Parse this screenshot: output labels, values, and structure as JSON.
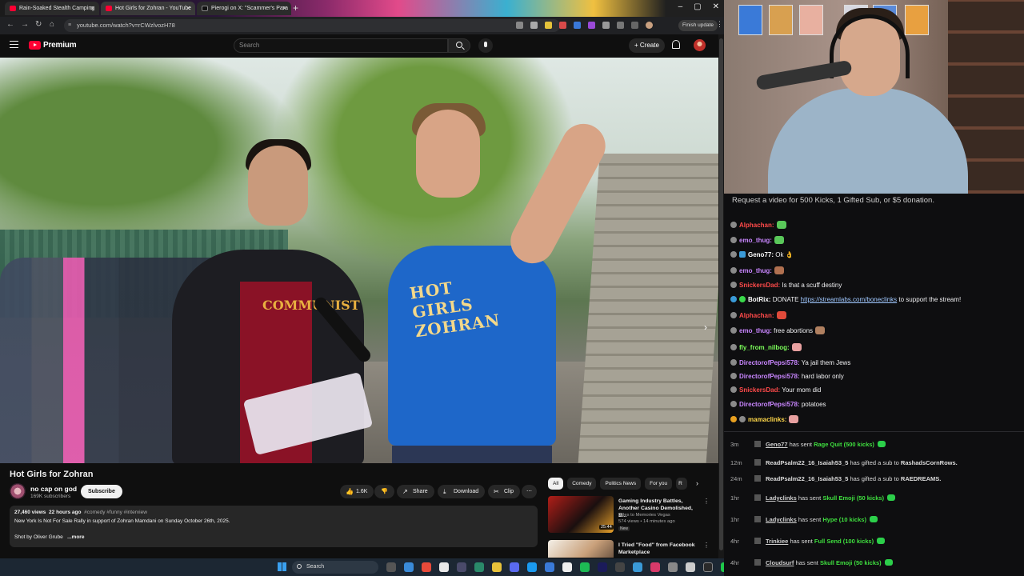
{
  "browser": {
    "tabs": [
      {
        "label": "Rain-Soaked Stealth Camping"
      },
      {
        "label": "Hot Girls for Zohran - YouTube"
      },
      {
        "label": "Pierogi on X: \"Scammer's Para"
      }
    ],
    "url": "youtube.com/watch?v=rCWzlvozH78",
    "finish_update": "Finish update"
  },
  "youtube": {
    "logo_text": "Premium",
    "search_placeholder": "Search",
    "create_label": "Create",
    "video": {
      "shirt_text": "HOT GIRLS ZOHRAN",
      "shirt_text2": "COMMUNIST",
      "title": "Hot Girls for Zohran",
      "channel": "no cap on god",
      "subscribers": "169K subscribers",
      "subscribe_label": "Subscribe",
      "likes": "1.6K",
      "share_label": "Share",
      "download_label": "Download",
      "clip_label": "Clip",
      "views": "27,460 views",
      "age": "22 hours ago",
      "tags": "#comedy #funny #interview",
      "description": "New York Is Not For Sale Rally in support of Zohran Mamdani on Sunday October 26th, 2025.",
      "shot_by": "Shot by Oliver Grube",
      "more_label": "...more"
    },
    "chips": [
      "All",
      "Comedy",
      "Politics News",
      "For you",
      "R"
    ],
    "recommendations": [
      {
        "title": "Gaming Industry Battles, Another Casino Demolished, B...",
        "channel": "Miles to Memories Vegas",
        "stats": "574 views • 14 minutes ago",
        "badge": "New",
        "duration": "25:44"
      },
      {
        "title": "I Tried \"Food\" from Facebook Marketplace",
        "channel": "",
        "stats": "",
        "badge": "",
        "duration": ""
      }
    ]
  },
  "taskbar": {
    "search_label": "Search"
  },
  "chat": {
    "banner": "Request a video for 500 Kicks, 1 Gifted Sub, or $5 donation.",
    "messages": [
      {
        "user": "Alphachan:",
        "text": "",
        "color": "#ff4a4a"
      },
      {
        "user": "emo_thug:",
        "text": "",
        "color": "#c986ff"
      },
      {
        "user": "Geno77:",
        "text": "Ok",
        "color": "#ffffff"
      },
      {
        "user": "emo_thug:",
        "text": "",
        "color": "#c986ff"
      },
      {
        "user": "SnickersDad:",
        "text": "Is that a scuff destiny",
        "color": "#ff4a4a"
      },
      {
        "user": "BotRix:",
        "text": "DONATE",
        "link": "https://streamlabs.com/boneclinks",
        "text2": "to support the stream!",
        "color": "#ffffff"
      },
      {
        "user": "Alphachan:",
        "text": "",
        "color": "#ff4a4a"
      },
      {
        "user": "emo_thug:",
        "text": "free abortions",
        "color": "#c986ff"
      },
      {
        "user": "fly_from_nilbog:",
        "text": "",
        "color": "#7cff5a"
      },
      {
        "user": "DirectorofPepsi578:",
        "text": "Ya jail them Jews",
        "color": "#c986ff"
      },
      {
        "user": "DirectorofPepsi578:",
        "text": "hard labor only",
        "color": "#c986ff"
      },
      {
        "user": "SnickersDad:",
        "text": "Your mom did",
        "color": "#ff4a4a"
      },
      {
        "user": "DirectorofPepsi578:",
        "text": "potatoes",
        "color": "#c986ff"
      },
      {
        "user": "mamaclinks:",
        "text": "",
        "color": "#ffd84a"
      }
    ],
    "events": [
      {
        "time": "3m",
        "user": "Geno77",
        "mid": "has sent",
        "item": "Rage Quit (500 kicks)",
        "kind": "kick"
      },
      {
        "time": "12m",
        "user": "ReadPsalm22_16_Isaiah53_5",
        "mid": "has gifted a sub to",
        "item": "RashadsCornRows.",
        "kind": "gift"
      },
      {
        "time": "24m",
        "user": "ReadPsalm22_16_Isaiah53_5",
        "mid": "has gifted a sub to",
        "item": "RAEDREAMS.",
        "kind": "gift"
      },
      {
        "time": "1hr",
        "user": "Ladyclinks",
        "mid": "has sent",
        "item": "Skull Emoji (50 kicks)",
        "kind": "kick"
      },
      {
        "time": "1hr",
        "user": "Ladyclinks",
        "mid": "has sent",
        "item": "Hype (10 kicks)",
        "kind": "kick"
      },
      {
        "time": "4hr",
        "user": "Trinkiee",
        "mid": "has sent",
        "item": "Full Send (100 kicks)",
        "kind": "kick"
      },
      {
        "time": "4hr",
        "user": "Cloudsurf",
        "mid": "has sent",
        "item": "Skull Emoji (50 kicks)",
        "kind": "kick"
      }
    ]
  }
}
